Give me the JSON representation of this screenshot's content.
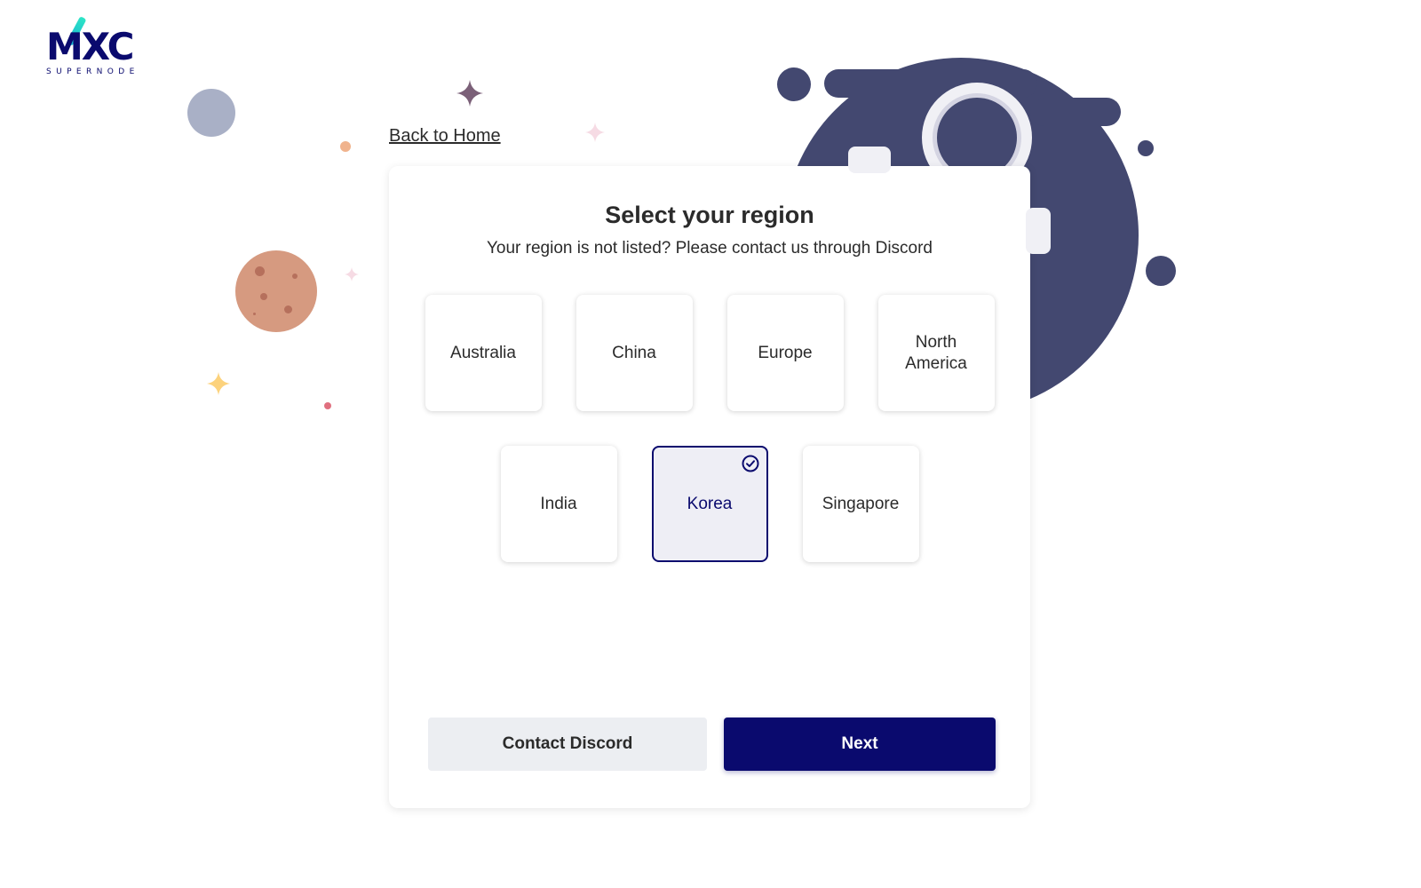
{
  "brand": {
    "logo_text": "MXC",
    "logo_subtext": "SUPERNODE"
  },
  "nav": {
    "back_label": "Back to Home"
  },
  "region_card": {
    "title": "Select your region",
    "subtitle": "Your region is not listed? Please contact us through Discord",
    "regions": [
      {
        "label": "Australia",
        "selected": false
      },
      {
        "label": "China",
        "selected": false
      },
      {
        "label": "Europe",
        "selected": false
      },
      {
        "label": "North America",
        "selected": false
      },
      {
        "label": "India",
        "selected": false
      },
      {
        "label": "Korea",
        "selected": true
      },
      {
        "label": "Singapore",
        "selected": false
      }
    ]
  },
  "actions": {
    "contact_label": "Contact Discord",
    "next_label": "Next"
  },
  "colors": {
    "primary": "#0a0a6e",
    "selected_bg": "#eeeef5",
    "secondary_button_bg": "#eceef2",
    "illustration": "#434870"
  }
}
